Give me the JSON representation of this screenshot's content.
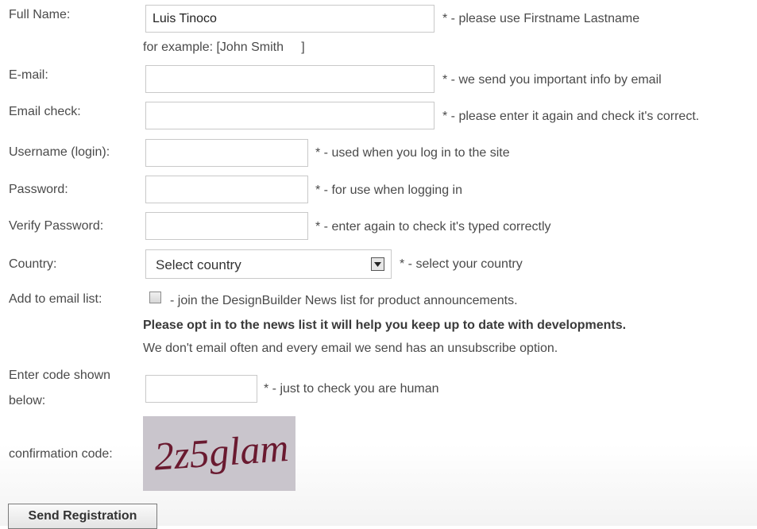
{
  "form": {
    "full_name": {
      "label": "Full Name:",
      "value": "Luis Tinoco",
      "note": "* - please use Firstname Lastname",
      "hint": "for example: [John Smith     ]"
    },
    "email": {
      "label": "E-mail:",
      "value": "",
      "note": "* - we send you important info by email"
    },
    "email_check": {
      "label": "Email check:",
      "value": "",
      "note": "* - please enter it again and check it's correct."
    },
    "username": {
      "label": "Username (login):",
      "value": "",
      "note": "* - used when you log in to the site"
    },
    "password": {
      "label": "Password:",
      "value": "",
      "note": "* - for use when logging in"
    },
    "verify_password": {
      "label": "Verify Password:",
      "value": "",
      "note": "* - enter again to check it's typed correctly"
    },
    "country": {
      "label": "Country:",
      "selected": "Select country",
      "note": "* - select your country"
    },
    "email_list": {
      "label": "Add to email list:",
      "checked": false,
      "note": "- join the DesignBuilder News list for product announcements.",
      "optin_bold": "Please opt in to the news list it will help you keep up to date with developments.",
      "optin_info": "We don't email often and every email we send has an unsubscribe option."
    },
    "code": {
      "label_line1": "Enter code shown",
      "label_line2": "below:",
      "value": "",
      "note": "* - just to check you are human"
    },
    "confirmation": {
      "label": "confirmation code:",
      "captcha_text": "2z5glam"
    },
    "submit_label": "Send Registration"
  }
}
